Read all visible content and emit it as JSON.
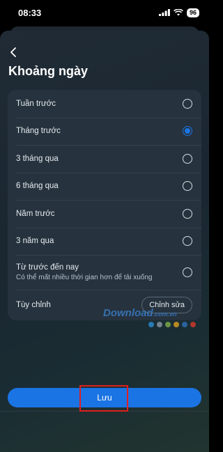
{
  "status_bar": {
    "time": "08:33",
    "battery": "96"
  },
  "header": {
    "title": "Khoảng ngày"
  },
  "options": [
    {
      "label": "Tuần trước",
      "selected": false
    },
    {
      "label": "Tháng trước",
      "selected": true
    },
    {
      "label": "3 tháng qua",
      "selected": false
    },
    {
      "label": "6 tháng qua",
      "selected": false
    },
    {
      "label": "Năm trước",
      "selected": false
    },
    {
      "label": "3 năm qua",
      "selected": false
    },
    {
      "label": "Từ trước đến nay",
      "sublabel": "Có thể mất nhiều thời gian hơn để tải xuống",
      "selected": false
    }
  ],
  "custom": {
    "label": "Tùy chỉnh",
    "edit_label": "Chỉnh sửa"
  },
  "footer": {
    "save_label": "Lưu"
  },
  "watermark": {
    "text": "Download",
    "suffix": ".com.vn"
  },
  "colors": {
    "accent": "#1b74e4",
    "highlight": "#e01f1f",
    "watermark_dots": [
      "#2b8fd6",
      "#8c9aa6",
      "#7fb04a",
      "#e0a21f",
      "#2e6fb8",
      "#d63a2b"
    ]
  }
}
